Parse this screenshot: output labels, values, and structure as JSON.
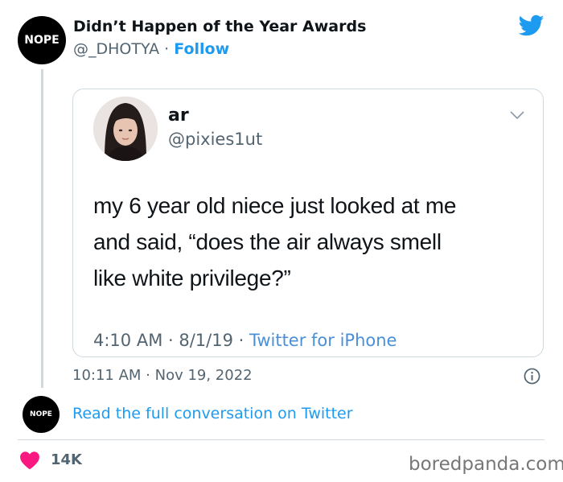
{
  "tweet": {
    "author": {
      "avatar_text": "NOPE",
      "name": "Didn’t Happen of the Year Awards",
      "handle": "@_DHOTYA",
      "separator": " · ",
      "follow_label": "Follow"
    },
    "timestamp": "10:11 AM · Nov 19, 2022"
  },
  "quoted_tweet": {
    "name": "ar",
    "handle": "@pixies1ut",
    "text_lines": [
      "my 6 year old niece just looked at me",
      "and said, “does the air always smell",
      "like white privilege?”"
    ],
    "meta_time": "4:10 AM · 8/1/19 · ",
    "meta_source": "Twitter for iPhone"
  },
  "conversation": {
    "avatar_text": "NOPE",
    "link_label": "Read the full conversation on Twitter"
  },
  "footer": {
    "likes": "14K",
    "watermark": "boredpanda.com"
  },
  "icons": {
    "brand": "twitter-bird-icon",
    "like": "heart-icon",
    "info": "info-icon",
    "menu": "chevron-down-icon"
  },
  "colors": {
    "link_blue": "#1d9bf0",
    "heart_red": "#f91880",
    "text_dark": "#0f1419",
    "text_gray": "#536471",
    "border": "#cfd9de"
  }
}
